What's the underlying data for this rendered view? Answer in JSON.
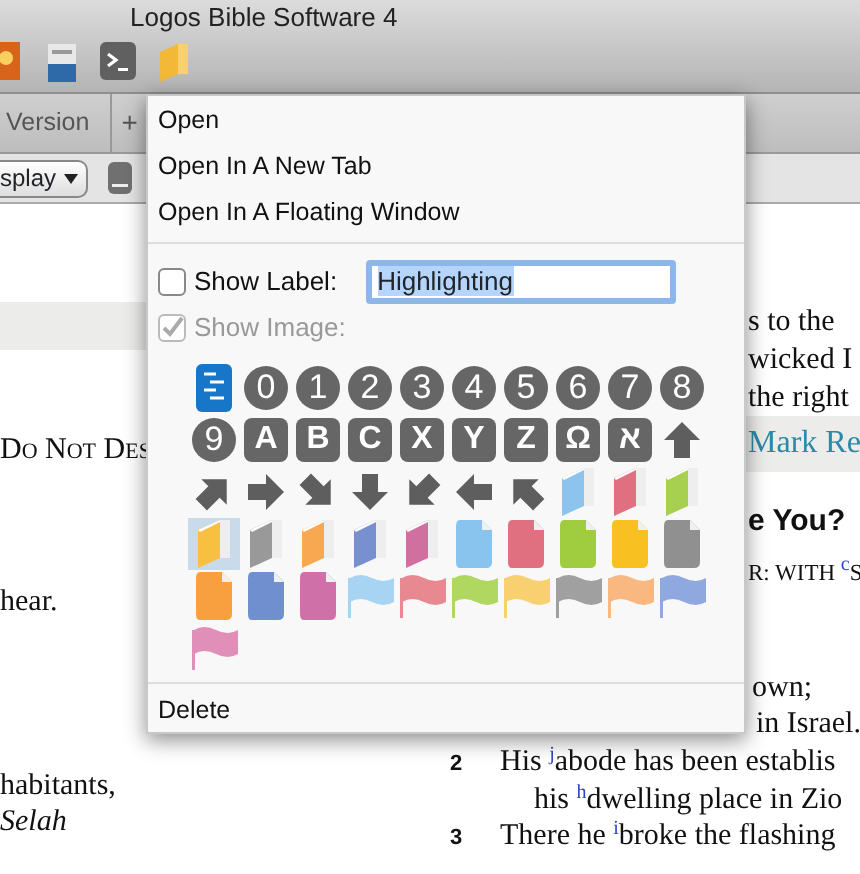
{
  "window": {
    "title": "Logos Bible Software 4"
  },
  "tab_strip": {
    "tabs": [
      "Version"
    ],
    "add_button": "+"
  },
  "display_dropdown": {
    "value": "splay"
  },
  "menu": {
    "items": [
      "Open",
      "Open In A New Tab",
      "Open In A Floating Window"
    ],
    "show_label": {
      "label": "Show Label:",
      "checked": false,
      "value": "Highlighting"
    },
    "show_image": {
      "label": "Show Image:",
      "checked": true,
      "disabled": true
    },
    "icons": [
      {
        "kind": "list",
        "selected": false
      },
      {
        "kind": "circle",
        "label": "0",
        "selected": false
      },
      {
        "kind": "circle",
        "label": "1",
        "selected": false
      },
      {
        "kind": "circle",
        "label": "2",
        "selected": false
      },
      {
        "kind": "circle",
        "label": "3",
        "selected": false
      },
      {
        "kind": "circle",
        "label": "4",
        "selected": false
      },
      {
        "kind": "circle",
        "label": "5",
        "selected": false
      },
      {
        "kind": "circle",
        "label": "6",
        "selected": false
      },
      {
        "kind": "circle",
        "label": "7",
        "selected": false
      },
      {
        "kind": "circle",
        "label": "8",
        "selected": false
      },
      {
        "kind": "circle",
        "label": "9",
        "selected": false
      },
      {
        "kind": "square",
        "label": "A",
        "selected": false
      },
      {
        "kind": "square",
        "label": "B",
        "selected": false
      },
      {
        "kind": "square",
        "label": "C",
        "selected": false
      },
      {
        "kind": "square",
        "label": "X",
        "selected": false
      },
      {
        "kind": "square",
        "label": "Y",
        "selected": false
      },
      {
        "kind": "square",
        "label": "Z",
        "selected": false
      },
      {
        "kind": "square",
        "label": "Ω",
        "selected": false
      },
      {
        "kind": "square",
        "label": "א",
        "selected": false
      },
      {
        "kind": "arrow",
        "selected": false
      },
      {
        "kind": "arrow",
        "selected": false
      },
      {
        "kind": "arrow",
        "selected": false
      },
      {
        "kind": "arrow",
        "selected": false
      },
      {
        "kind": "arrow",
        "selected": false
      },
      {
        "kind": "arrow",
        "selected": false
      },
      {
        "kind": "arrow",
        "selected": false
      },
      {
        "kind": "arrow",
        "selected": false
      },
      {
        "kind": "book",
        "color": "#8cc4ee",
        "selected": false
      },
      {
        "kind": "book",
        "color": "#e07080",
        "selected": false
      },
      {
        "kind": "book",
        "color": "#a8d050",
        "selected": false
      },
      {
        "kind": "book",
        "color": "#f8c040",
        "selected": true
      },
      {
        "kind": "book",
        "color": "#999999",
        "selected": false
      },
      {
        "kind": "book",
        "color": "#f8a850",
        "selected": false
      },
      {
        "kind": "book",
        "color": "#7890d0",
        "selected": false
      },
      {
        "kind": "book",
        "color": "#d070a0",
        "selected": false
      },
      {
        "kind": "doc",
        "color": "#88c4ee",
        "selected": false
      },
      {
        "kind": "doc",
        "color": "#e07080",
        "selected": false
      },
      {
        "kind": "doc",
        "color": "#a0cc40",
        "selected": false
      },
      {
        "kind": "doc",
        "color": "#f8c020",
        "selected": false
      },
      {
        "kind": "doc",
        "color": "#909090",
        "selected": false
      },
      {
        "kind": "doc",
        "color": "#f8a040",
        "selected": false
      },
      {
        "kind": "doc",
        "color": "#6f8fcf",
        "selected": false
      },
      {
        "kind": "doc",
        "color": "#d070a8",
        "selected": false
      },
      {
        "kind": "flag",
        "color": "#a8d4f4",
        "selected": false
      },
      {
        "kind": "flag",
        "color": "#e88890",
        "selected": false
      },
      {
        "kind": "flag",
        "color": "#b0d860",
        "selected": false
      },
      {
        "kind": "flag",
        "color": "#f8d070",
        "selected": false
      },
      {
        "kind": "flag",
        "color": "#a0a0a0",
        "selected": false
      },
      {
        "kind": "flag",
        "color": "#f8b880",
        "selected": false
      },
      {
        "kind": "flag",
        "color": "#90a8e0",
        "selected": false
      },
      {
        "kind": "flag",
        "color": "#e090b8",
        "selected": false
      }
    ],
    "delete": "Delete"
  },
  "document": {
    "left_lines": [
      {
        "kind": "band"
      },
      {
        "kind": "smallcaps",
        "text": "Do Not Des"
      },
      {
        "kind": "plain",
        "text": "hear."
      },
      {
        "kind": "plain",
        "text": "habitants,"
      },
      {
        "kind": "italic",
        "text": "Selah"
      }
    ],
    "right_lines": [
      {
        "kind": "plain",
        "text": "s to the"
      },
      {
        "kind": "plain",
        "text": "wicked I"
      },
      {
        "kind": "plain",
        "text": "the right"
      },
      {
        "kind": "band",
        "text": "Mark Re"
      },
      {
        "kind": "heading",
        "text": "e You?"
      },
      {
        "kind": "caps",
        "text": "R: WITH $^{c}$S"
      },
      {
        "kind": "plain",
        "text": "own;"
      },
      {
        "kind": "plain",
        "text": "in Israel."
      },
      {
        "kind": "verse",
        "verse": "2",
        "text": "His $^{j}$abode has been establis"
      },
      {
        "kind": "plain",
        "text": "his $^{h}$dwelling place in Zio"
      },
      {
        "kind": "verse",
        "verse": "3",
        "text": "There he $^{i}$broke the flashing"
      }
    ]
  }
}
